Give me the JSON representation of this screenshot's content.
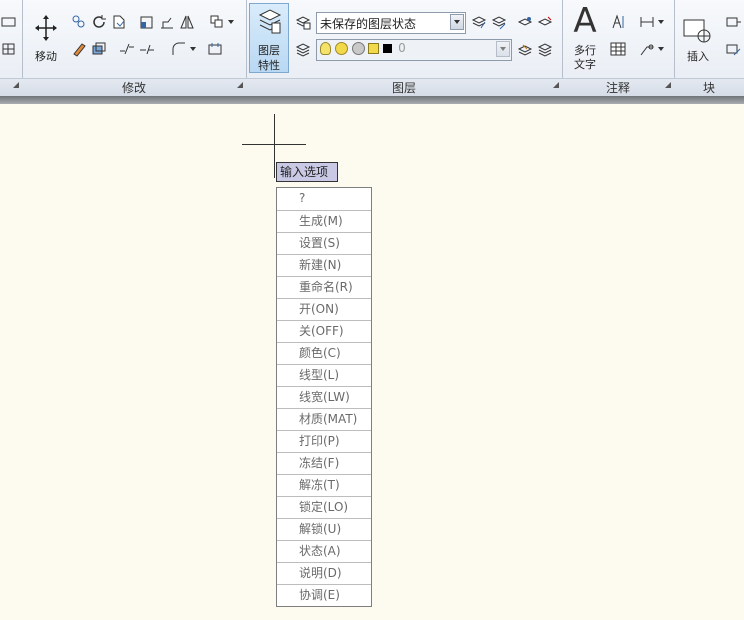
{
  "ribbon": {
    "panels": {
      "modify": {
        "title": "修改",
        "move_label": "移动"
      },
      "layers": {
        "title": "图层",
        "layer_props_label_line1": "图层",
        "layer_props_label_line2": "特性",
        "layer_state_value": "未保存的图层状态",
        "current_layer_value": "0"
      },
      "annotation": {
        "title": "注释",
        "mtext_line1": "多行",
        "mtext_line2": "文字"
      },
      "block": {
        "title": "块",
        "insert_label": "插入"
      }
    }
  },
  "canvas": {
    "prompt_label": "输入选项",
    "options": [
      "?",
      "生成(M)",
      "设置(S)",
      "新建(N)",
      "重命名(R)",
      "开(ON)",
      "关(OFF)",
      "颜色(C)",
      "线型(L)",
      "线宽(LW)",
      "材质(MAT)",
      "打印(P)",
      "冻结(F)",
      "解冻(T)",
      "锁定(LO)",
      "解锁(U)",
      "状态(A)",
      "说明(D)",
      "协调(E)"
    ]
  }
}
